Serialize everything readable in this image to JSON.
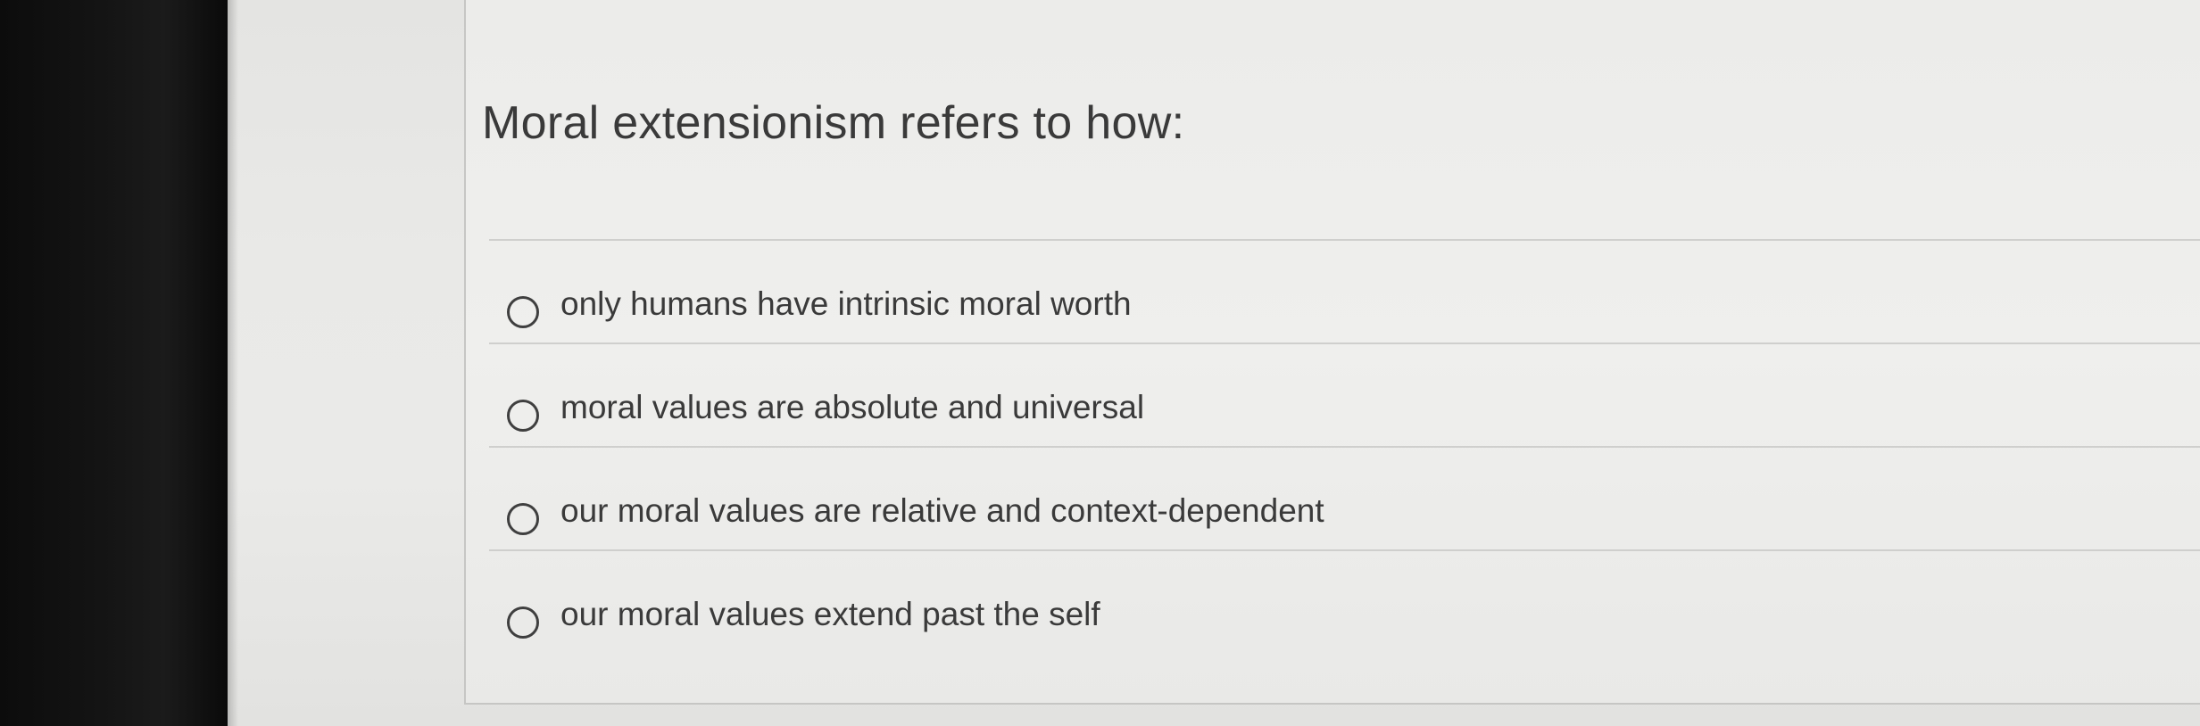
{
  "question": {
    "prompt": "Moral extensionism refers to how:"
  },
  "options": [
    {
      "label": "only humans have intrinsic moral worth",
      "selected": false
    },
    {
      "label": "moral values are absolute and universal",
      "selected": false
    },
    {
      "label": "our moral values are relative and context-dependent",
      "selected": false
    },
    {
      "label": "our moral values extend past the self",
      "selected": false
    }
  ]
}
